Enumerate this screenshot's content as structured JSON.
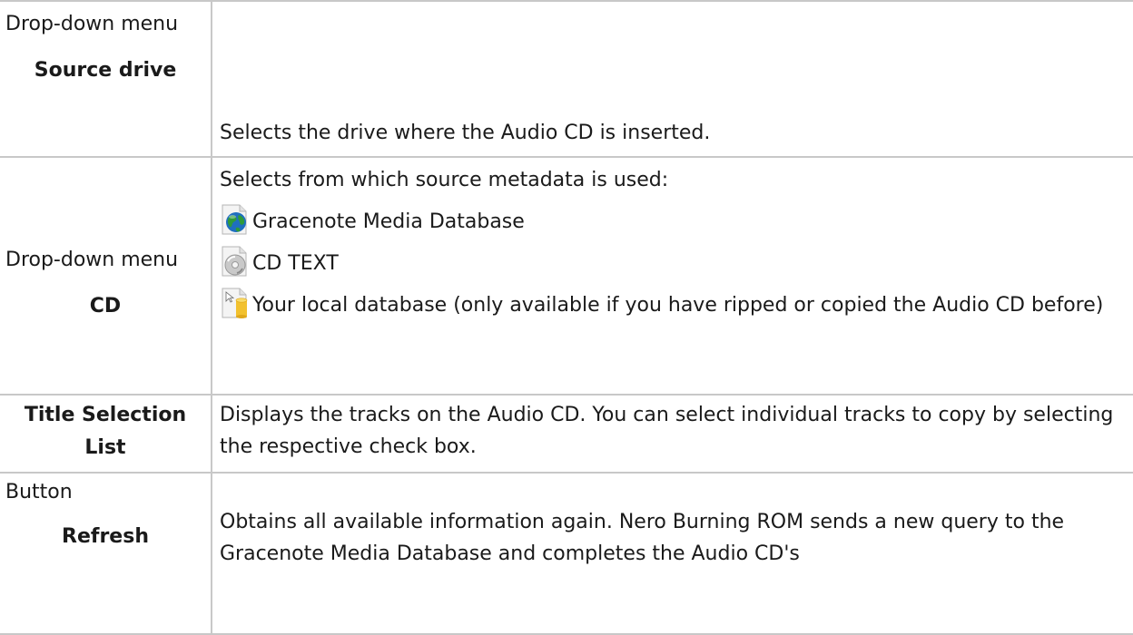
{
  "rows": [
    {
      "kind": "Drop-down menu",
      "name": "Source drive",
      "description": "Selects the drive where the Audio CD is inserted."
    },
    {
      "kind": "Drop-down menu",
      "name": "CD",
      "description": "Selects from which source metadata is used:",
      "sources": [
        {
          "icon": "globe-icon",
          "label": "Gracenote Media Database"
        },
        {
          "icon": "cd-disc-icon",
          "label": "CD TEXT"
        },
        {
          "icon": "local-database-icon",
          "label": "Your local database (only available if you have ripped or copied the Audio CD before)"
        }
      ]
    },
    {
      "kind": "",
      "name": "Title Selection List",
      "description": "Displays the tracks on the Audio CD. You can select individual tracks to copy by selecting the respective check box."
    },
    {
      "kind": "Button",
      "name": "Refresh",
      "description": "Obtains all available information again. Nero Burning ROM sends a new query to the Gracenote Media Database and completes the Audio CD's"
    }
  ],
  "colors": {
    "border": "#c8c8c8",
    "text": "#1a1a1a",
    "globe": "#2e8b3a",
    "database": "#f2c12e"
  }
}
